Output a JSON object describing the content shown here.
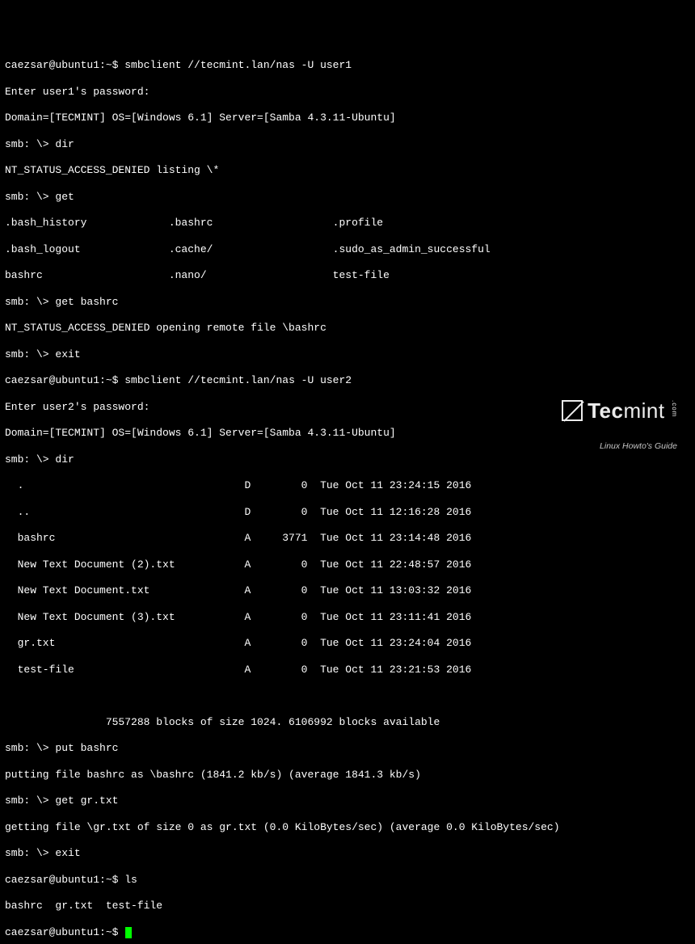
{
  "session1": {
    "prompt": "caezsar@ubuntu1:~$ ",
    "cmd": "smbclient //tecmint.lan/nas -U user1",
    "pwprompt": "Enter user1's password:",
    "banner": "Domain=[TECMINT] OS=[Windows 6.1] Server=[Samba 4.3.11-Ubuntu]",
    "smb_dir": "smb: \\> dir",
    "dir_err": "NT_STATUS_ACCESS_DENIED listing \\*",
    "smb_get": "smb: \\> get",
    "row1": ".bash_history             .bashrc                   .profile",
    "row2": ".bash_logout              .cache/                   .sudo_as_admin_successful",
    "row3": "bashrc                    .nano/                    test-file",
    "smb_get_bashrc": "smb: \\> get bashrc",
    "get_err": "NT_STATUS_ACCESS_DENIED opening remote file \\bashrc",
    "smb_exit": "smb: \\> exit"
  },
  "session2": {
    "prompt": "caezsar@ubuntu1:~$ ",
    "cmd": "smbclient //tecmint.lan/nas -U user2",
    "pwprompt": "Enter user2's password:",
    "banner": "Domain=[TECMINT] OS=[Windows 6.1] Server=[Samba 4.3.11-Ubuntu]",
    "smb_dir": "smb: \\> dir",
    "rows": {
      "r1": "  .                                   D        0  Tue Oct 11 23:24:15 2016",
      "r2": "  ..                                  D        0  Tue Oct 11 12:16:28 2016",
      "r3": "  bashrc                              A     3771  Tue Oct 11 23:14:48 2016",
      "r4": "  New Text Document (2).txt           A        0  Tue Oct 11 22:48:57 2016",
      "r5": "  New Text Document.txt               A        0  Tue Oct 11 13:03:32 2016",
      "r6": "  New Text Document (3).txt           A        0  Tue Oct 11 23:11:41 2016",
      "r7": "  gr.txt                              A        0  Tue Oct 11 23:24:04 2016",
      "r8": "  test-file                           A        0  Tue Oct 11 23:21:53 2016"
    },
    "blocks": "                7557288 blocks of size 1024. 6106992 blocks available",
    "smb_put": "smb: \\> put bashrc",
    "put_msg": "putting file bashrc as \\bashrc (1841.2 kb/s) (average 1841.3 kb/s)",
    "smb_get_gr": "smb: \\> get gr.txt",
    "get_msg": "getting file \\gr.txt of size 0 as gr.txt (0.0 KiloBytes/sec) (average 0.0 KiloBytes/sec)",
    "smb_exit": "smb: \\> exit"
  },
  "tail": {
    "prompt": "caezsar@ubuntu1:~$ ",
    "ls": "ls",
    "ls_out": "bashrc  gr.txt  test-file",
    "prompt2": "caezsar@ubuntu1:~$ "
  },
  "watermark": {
    "brand_bold": "Tec",
    "brand_light": "mint",
    "com": ".com",
    "tag": "Linux Howto's Guide"
  }
}
